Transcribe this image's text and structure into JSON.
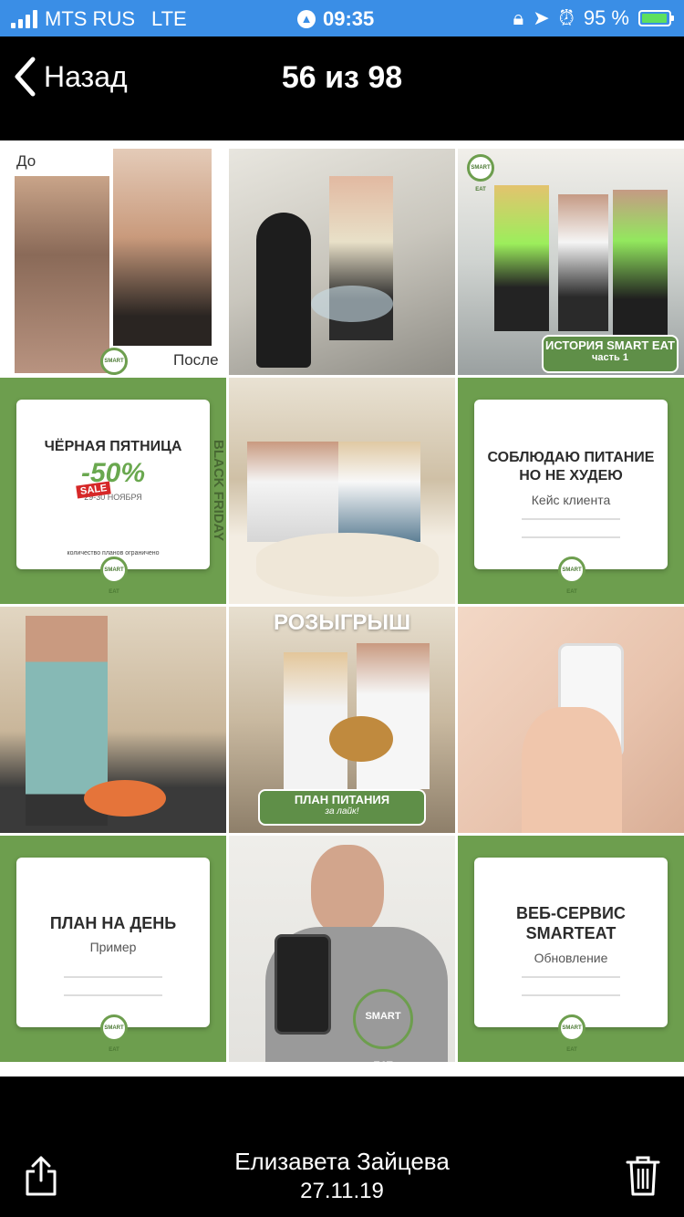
{
  "status_bar": {
    "carrier": "MTS RUS",
    "network": "LTE",
    "time": "09:35",
    "battery_percent": "95 %",
    "battery_level": 0.95
  },
  "nav": {
    "back_label": "Назад",
    "title": "56 из 98"
  },
  "tiles": {
    "t1": {
      "before": "До",
      "after": "После"
    },
    "t3": {
      "banner_title": "ИСТОРИЯ SMART EAT",
      "banner_sub": "часть 1"
    },
    "t4": {
      "title": "ЧЁРНАЯ ПЯТНИЦА",
      "discount": "-50%",
      "sale": "SALE",
      "dates": "29-30 НОЯБРЯ",
      "note": "количество планов ограничено",
      "side_text": "BLACK FRIDAY"
    },
    "t6": {
      "title": "СОБЛЮДАЮ ПИТАНИЕ НО НЕ ХУДЕЮ",
      "subtitle": "Кейс клиента"
    },
    "t8": {
      "top": "РОЗЫГРЫШ",
      "banner_title": "ПЛАН ПИТАНИЯ",
      "banner_sub": "за лайк!"
    },
    "t10": {
      "title": "ПЛАН НА ДЕНЬ",
      "subtitle": "Пример"
    },
    "t11": {
      "hoodie": "SMART EAT"
    },
    "t12": {
      "title": "ВЕБ-СЕРВИС SMARTEAT",
      "subtitle": "Обновление"
    },
    "logo": "SMART EAT"
  },
  "bottom": {
    "owner": "Елизавета Зайцева",
    "date": "27.11.19"
  },
  "colors": {
    "status_bar": "#3a8ee6",
    "green": "#6d9e4e"
  }
}
